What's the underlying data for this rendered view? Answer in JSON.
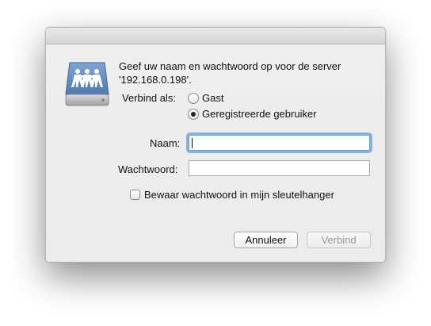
{
  "dialog": {
    "prompt_line1": "Geef uw naam en wachtwoord op voor de server",
    "prompt_line2": "'192.168.0.198'.",
    "connect_as_label": "Verbind als:",
    "radio_guest": "Gast",
    "radio_registered": "Geregistreerde gebruiker",
    "selected_option": "registered",
    "name_label": "Naam:",
    "name_value": "",
    "password_label": "Wachtwoord:",
    "password_value": "",
    "keychain_label": "Bewaar wachtwoord in mijn sleutelhanger",
    "keychain_checked": false,
    "cancel_label": "Annuleer",
    "connect_label": "Verbind",
    "connect_enabled": false
  },
  "icon": "shared-server-icon",
  "colors": {
    "dialog_bg": "#ececec",
    "focus_ring": "#609ee6",
    "icon_blue": "#5b87b8"
  }
}
